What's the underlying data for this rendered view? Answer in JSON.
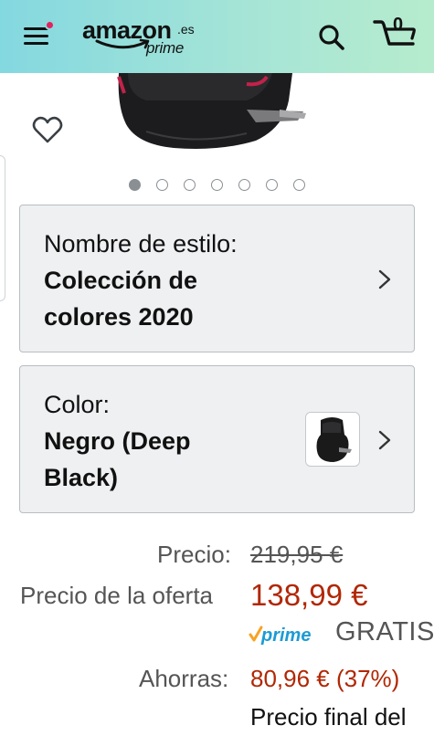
{
  "header": {
    "menu_icon": "hamburger-menu-icon",
    "notification_dot_color": "#e0245e",
    "logo": {
      "word": "amazon",
      "domain": ".es",
      "tier": "prime"
    },
    "search_icon": "search-icon",
    "cart_icon": "cart-icon",
    "cart_count": "0",
    "gradient_colors": [
      "#84d8e0",
      "#b6eccd"
    ]
  },
  "gallery": {
    "wishlist_icon": "heart-outline-icon",
    "total_images": 7,
    "active_index": 0
  },
  "style_selector": {
    "label": "Nombre de estilo:",
    "value_line1": "Colección de",
    "value_line2": "colores 2020",
    "chevron_icon": "chevron-right-icon"
  },
  "color_selector": {
    "label": "Color:",
    "value_line1": "Negro (Deep",
    "value_line2": "Black)",
    "swatch_icon": "car-seat-thumbnail",
    "chevron_icon": "chevron-right-icon"
  },
  "pricing": {
    "list_price_label": "Precio:",
    "list_price": "219,95 €",
    "deal_price_label": "Precio de la oferta",
    "deal_price": "138,99 €",
    "prime_badge": "prime",
    "shipping": "GRATIS",
    "savings_label": "Ahorras:",
    "savings": "80,96 € (37%)",
    "final_price_text": "Precio final del"
  },
  "colors": {
    "deal_red": "#b12704",
    "prime_blue": "#1d9bd4",
    "prime_check_orange": "#f7a325"
  }
}
